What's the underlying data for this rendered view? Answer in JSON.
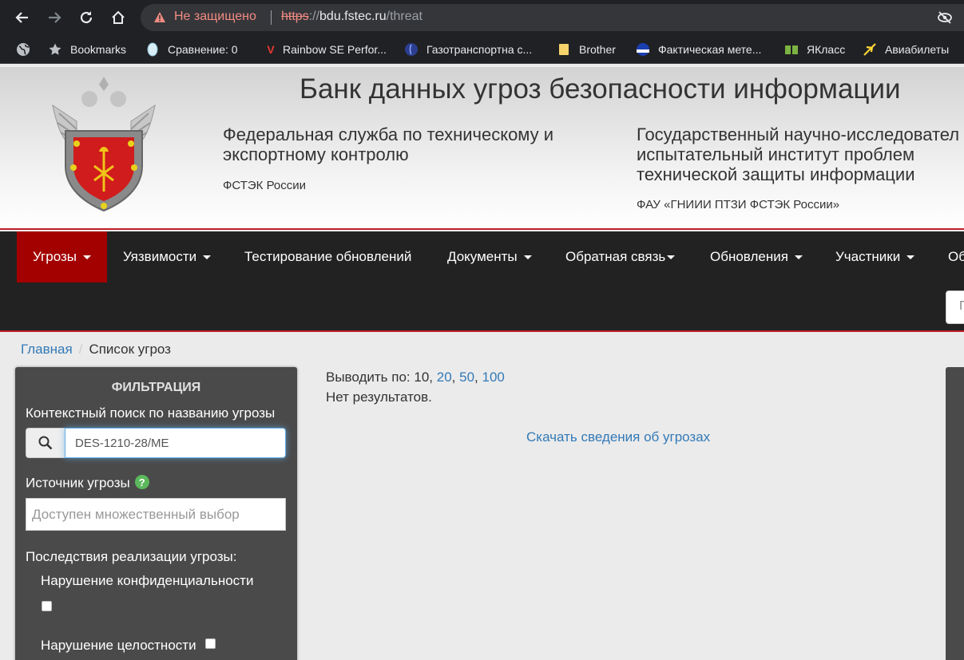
{
  "browser": {
    "security_warning": "Не защищено",
    "url_scheme": "https",
    "url_sep": "://",
    "url_host": "bdu.fstec.ru",
    "url_path": "/threat",
    "bookmarks": [
      {
        "label": "Bookmarks",
        "icon": "star-icon"
      },
      {
        "label": "Сравнение: 0",
        "icon": "compare-icon"
      },
      {
        "label": "Rainbow SE Perfor...",
        "icon": "v-logo-icon"
      },
      {
        "label": "Газотранспортна с...",
        "icon": "globe-blue-icon"
      },
      {
        "label": "Brother",
        "icon": "folder-icon"
      },
      {
        "label": "Фактическая мете...",
        "icon": "weather-icon"
      },
      {
        "label": "ЯКласс",
        "icon": "book-icon"
      },
      {
        "label": "Авиабилеты",
        "icon": "plane-icon"
      }
    ]
  },
  "header": {
    "title": "Банк данных угроз безопасности информации",
    "org1": {
      "line1": "Федеральная служба по техническому и",
      "line2": "экспортному контролю",
      "short": "ФСТЭК России"
    },
    "org2": {
      "line1": "Государственный научно-исследовател",
      "line2": "испытательный институт проблем",
      "line3": "технической защиты информации",
      "short": "ФАУ «ГНИИИ ПТЗИ ФСТЭК России»"
    }
  },
  "navbar": {
    "items": [
      "Угрозы",
      "Уязвимости",
      "Тестирование обновлений",
      "Документы",
      "Обратная связь",
      "Обновления",
      "Участники",
      "Об"
    ],
    "search_placeholder": "П"
  },
  "breadcrumb": {
    "home": "Главная",
    "sep": "/",
    "current": "Список угроз"
  },
  "filter": {
    "title": "ФИЛЬТРАЦИЯ",
    "context_search_label": "Контекстный поиск по названию угрозы",
    "context_search_value": "DES-1210-28/ME",
    "source_label": "Источник угрозы",
    "help_badge": "?",
    "source_placeholder": "Доступен множественный выбор",
    "consequences_label": "Последствия реализации угрозы:",
    "checkbox_confidentiality": "Нарушение конфиденциальности",
    "checkbox_integrity": "Нарушение целостности"
  },
  "content": {
    "per_page_label": "Выводить по: 10,",
    "per_page_options": [
      "20",
      "50",
      "100"
    ],
    "comma": ",",
    "no_results": "Нет результатов.",
    "download_link": "Скачать сведения об угрозах"
  },
  "colors": {
    "nav_active": "#a30000",
    "nav_bg": "#222222",
    "link": "#337ab7",
    "filter_bg": "#4a4a4a",
    "accent_red": "#c0202a"
  }
}
